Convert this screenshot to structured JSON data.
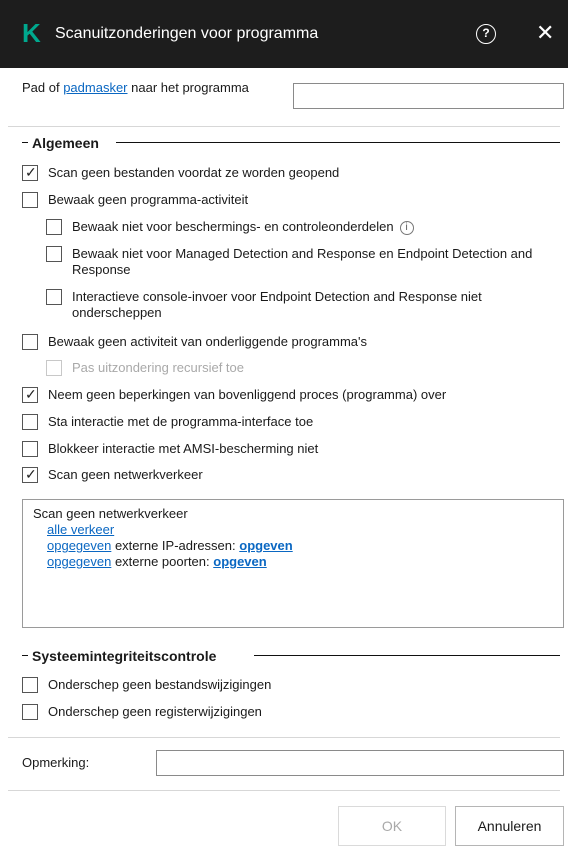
{
  "window": {
    "title": "Scanuitzonderingen voor programma",
    "logo_letter": "K",
    "help_glyph": "?",
    "close_glyph": "✕"
  },
  "path": {
    "prefix": "Pad of ",
    "link": "padmasker",
    "suffix": " naar het programma",
    "value": ""
  },
  "general": {
    "heading": "Algemeen",
    "options": [
      {
        "label": "Scan geen bestanden voordat ze worden geopend",
        "checked": true,
        "enabled": true
      },
      {
        "label": "Bewaak geen programma-activiteit",
        "checked": false,
        "enabled": true
      },
      {
        "label": "Bewaak niet voor beschermings- en controleonderdelen",
        "checked": false,
        "enabled": true,
        "info_glyph": "i"
      },
      {
        "label": "Bewaak niet voor Managed Detection and Response en Endpoint Detection and Response",
        "checked": false,
        "enabled": true
      },
      {
        "label": "Interactieve console-invoer voor Endpoint Detection and Response niet onderscheppen",
        "checked": false,
        "enabled": true
      },
      {
        "label": "Bewaak geen activiteit van onderliggende programma's",
        "checked": false,
        "enabled": true
      },
      {
        "label": "Pas uitzondering recursief toe",
        "checked": false,
        "enabled": false
      },
      {
        "label": "Neem geen beperkingen van bovenliggend proces (programma) over",
        "checked": true,
        "enabled": true
      },
      {
        "label": "Sta interactie met de programma-interface toe",
        "checked": false,
        "enabled": true
      },
      {
        "label": "Blokkeer interactie met AMSI-bescherming niet",
        "checked": false,
        "enabled": true
      },
      {
        "label": "Scan geen netwerkverkeer",
        "checked": true,
        "enabled": true
      }
    ]
  },
  "network_box": {
    "title": "Scan geen netwerkverkeer",
    "all_traffic": "alle verkeer",
    "ip_line": {
      "link1": "opgegeven",
      "text": " externe IP-adressen: ",
      "link2": "opgeven"
    },
    "port_line": {
      "link1": "opgegeven",
      "text": " externe poorten: ",
      "link2": "opgeven"
    }
  },
  "integrity": {
    "heading": "Systeemintegriteitscontrole",
    "options": [
      {
        "label": "Onderschep geen bestandswijzigingen",
        "checked": false
      },
      {
        "label": "Onderschep geen registerwijzigingen",
        "checked": false
      }
    ]
  },
  "remark": {
    "label": "Opmerking:",
    "value": ""
  },
  "buttons": {
    "ok": "OK",
    "cancel": "Annuleren",
    "ok_enabled": false
  },
  "colors": {
    "titlebar": "#1d1d1d",
    "brand": "#00a88e",
    "link": "#0a67c2"
  }
}
